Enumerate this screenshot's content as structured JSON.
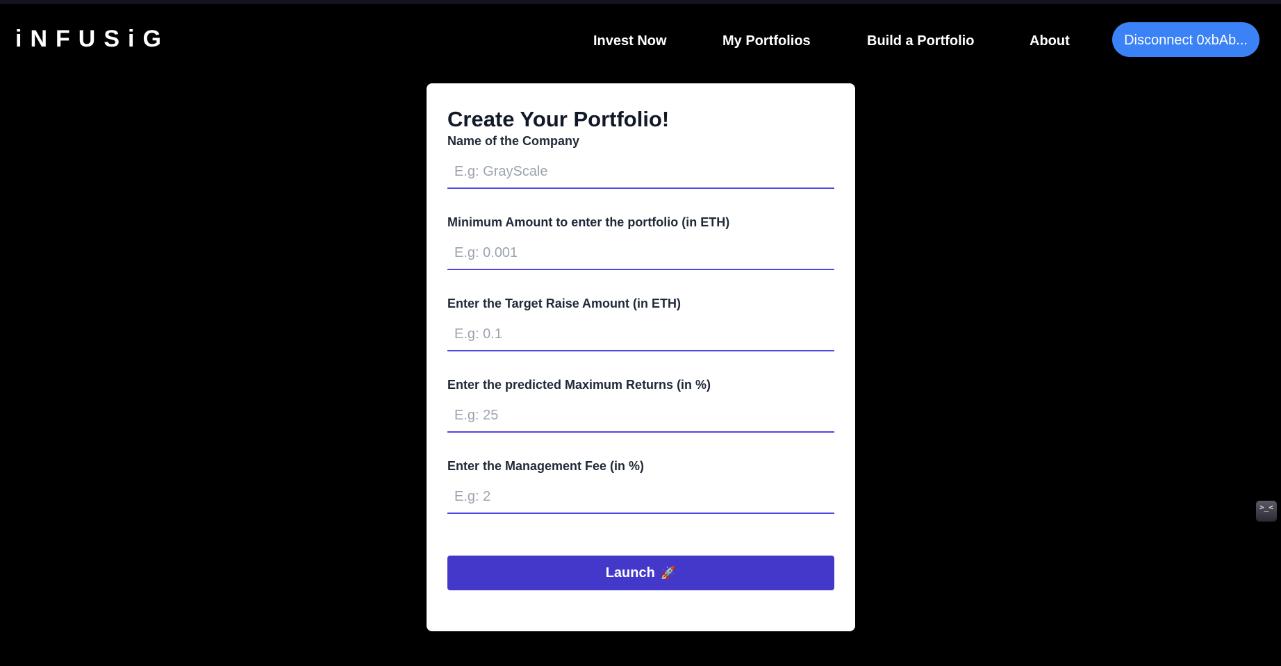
{
  "brand": {
    "logo_text": "iNFUSiG"
  },
  "nav": {
    "links": [
      {
        "label": "Invest Now"
      },
      {
        "label": "My Portfolios"
      },
      {
        "label": "Build a Portfolio"
      },
      {
        "label": "About"
      }
    ],
    "wallet_button_label": "Disconnect 0xbAb...",
    "wallet_button_color": "#3b82f6"
  },
  "form": {
    "title": "Create Your Portfolio!",
    "fields": [
      {
        "label": "Name of the Company",
        "value": "",
        "placeholder": "E.g: GrayScale"
      },
      {
        "label": "Minimum Amount to enter the portfolio (in ETH)",
        "value": "",
        "placeholder": "E.g: 0.001"
      },
      {
        "label": "Enter the Target Raise Amount (in ETH)",
        "value": "",
        "placeholder": "E.g: 0.1"
      },
      {
        "label": "Enter the predicted Maximum Returns (in %)",
        "value": "",
        "placeholder": "E.g: 25"
      },
      {
        "label": "Enter the Management Fee (in %)",
        "value": "",
        "placeholder": "E.g: 2"
      }
    ],
    "submit_label": "Launch",
    "submit_icon": "🚀",
    "submit_color": "#4338ca",
    "accent_color": "#4f46e5"
  },
  "side_widget": {
    "icon": "terminal-icon",
    "glyph": ">_<"
  }
}
